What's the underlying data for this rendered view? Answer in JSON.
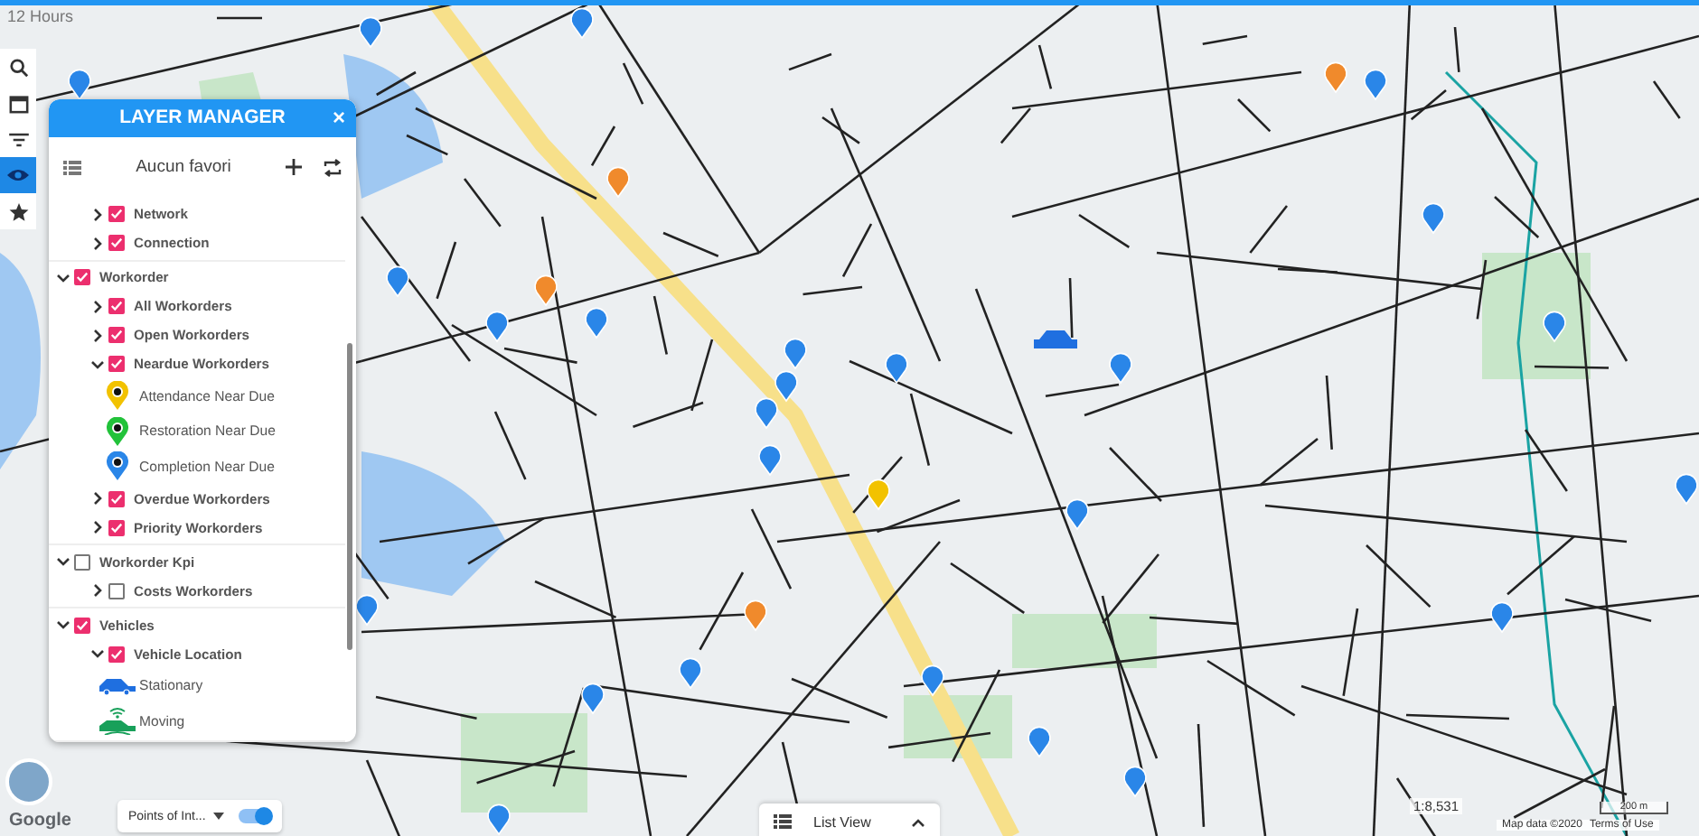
{
  "timeline": {
    "label": "12 Hours"
  },
  "tools": [
    {
      "kind": "search",
      "selected": false
    },
    {
      "kind": "calendar",
      "selected": false
    },
    {
      "kind": "filter",
      "selected": false
    },
    {
      "kind": "eye",
      "selected": true
    },
    {
      "kind": "star",
      "selected": false
    }
  ],
  "layer_manager": {
    "title": "LAYER MANAGER",
    "close": "×",
    "favorites": {
      "label": "Aucun favori"
    },
    "tree": [
      {
        "kind": "group",
        "children": [
          {
            "kind": "layer",
            "label": "Network",
            "checked": true,
            "expanded": false
          },
          {
            "kind": "layer",
            "label": "Connection",
            "checked": true,
            "expanded": false
          }
        ]
      },
      {
        "kind": "layer",
        "label": "Workorder",
        "checked": true,
        "expanded": true,
        "children": [
          {
            "kind": "layer",
            "label": "All Workorders",
            "checked": true,
            "expanded": false
          },
          {
            "kind": "layer",
            "label": "Open Workorders",
            "checked": true,
            "expanded": false
          },
          {
            "kind": "layer",
            "label": "Neardue Workorders",
            "checked": true,
            "expanded": true,
            "children": [
              {
                "kind": "pin",
                "color": "#f2c200",
                "label": "Attendance Near Due"
              },
              {
                "kind": "pin",
                "color": "#22c23a",
                "label": "Restoration Near Due"
              },
              {
                "kind": "pin",
                "color": "#2a86e8",
                "label": "Completion Near Due"
              }
            ]
          },
          {
            "kind": "layer",
            "label": "Overdue Workorders",
            "checked": true,
            "expanded": false
          },
          {
            "kind": "layer",
            "label": "Priority Workorders",
            "checked": true,
            "expanded": false
          }
        ]
      },
      {
        "kind": "layer",
        "label": "Workorder Kpi",
        "checked": false,
        "expanded": true,
        "children": [
          {
            "kind": "layer",
            "label": "Costs Workorders",
            "checked": false,
            "expanded": false
          }
        ]
      },
      {
        "kind": "layer",
        "label": "Vehicles",
        "checked": true,
        "expanded": true,
        "children": [
          {
            "kind": "layer",
            "label": "Vehicle Location",
            "checked": true,
            "expanded": true,
            "children": [
              {
                "kind": "car",
                "color": "#1f6fe0",
                "label": "Stationary"
              },
              {
                "kind": "moving",
                "color": "#18a05a",
                "label": "Moving"
              }
            ]
          }
        ]
      }
    ]
  },
  "points_of_interest": {
    "label": "Points of Int...",
    "on": true
  },
  "list_view": {
    "label": "List View"
  },
  "scale": {
    "ratio": "1:8,531",
    "distance": "200 m"
  },
  "attribution": {
    "logo": "Google",
    "data": "Map data ©2020",
    "terms": "Terms of Use"
  }
}
